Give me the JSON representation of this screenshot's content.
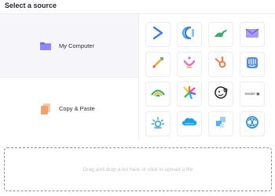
{
  "header": {
    "title": "Select a source"
  },
  "sources": [
    {
      "label": "My Computer",
      "icon": "folder-icon",
      "active": true
    },
    {
      "label": "Copy & Paste",
      "icon": "copy-paste-icon",
      "active": false
    }
  ],
  "integrations": [
    {
      "icon": "blue-chevron-logo-icon"
    },
    {
      "icon": "blue-rings-logo-icon"
    },
    {
      "icon": "green-dinosaur-logo-icon"
    },
    {
      "icon": "purple-envelope-logo-icon"
    },
    {
      "icon": "rocket-logo-icon"
    },
    {
      "icon": "pink-smile-logo-icon"
    },
    {
      "icon": "hubspot-logo-icon"
    },
    {
      "icon": "intercom-logo-icon"
    },
    {
      "icon": "green-wifi-arcs-logo-icon"
    },
    {
      "icon": "colorful-burst-logo-icon"
    },
    {
      "icon": "mailchimp-logo-icon"
    },
    {
      "icon": "text-wordmark-logo-icon",
      "label": "Insider ▣"
    },
    {
      "icon": "sun-rays-logo-icon"
    },
    {
      "icon": "salesforce-logo-icon",
      "label": "salesforce"
    },
    {
      "icon": "blue-squares-logo-icon"
    },
    {
      "icon": "blue-knot-logo-icon"
    }
  ],
  "dropzone": {
    "text": "Drag and drop a list here or click to upload a file"
  },
  "colors": {
    "accent": "#5b5ff5",
    "border": "#ececf1",
    "dashed": "#8d88b8"
  }
}
